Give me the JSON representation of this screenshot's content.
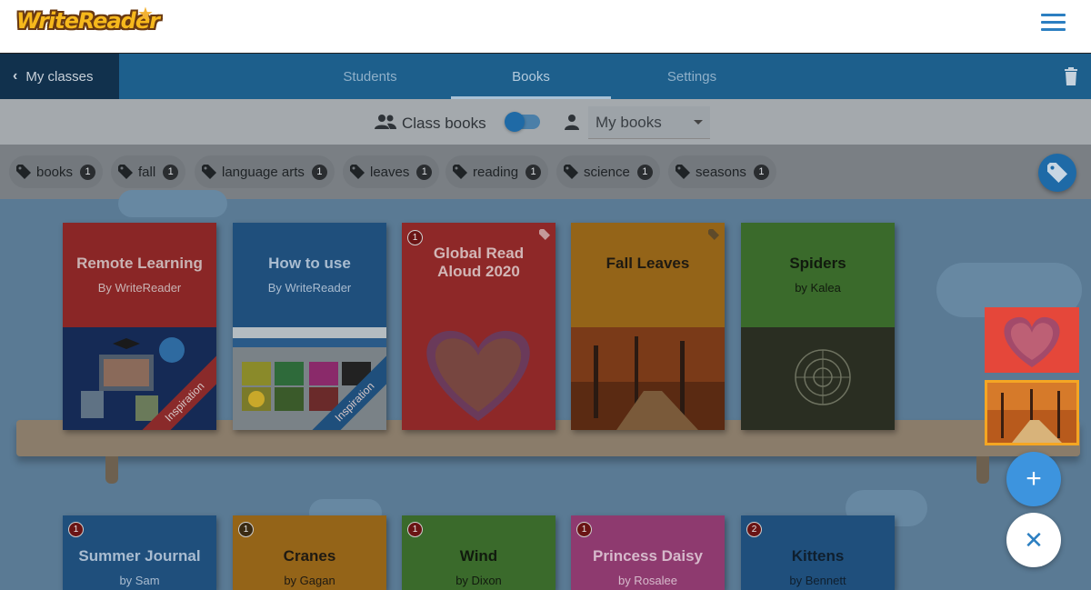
{
  "header": {
    "logo_text": "WriteReader",
    "star_glyph": "★",
    "menu_icon": "hamburger-icon"
  },
  "nav": {
    "back_label": "My classes",
    "tabs": [
      {
        "label": "Students",
        "active": false
      },
      {
        "label": "Books",
        "active": true
      },
      {
        "label": "Settings",
        "active": false
      }
    ],
    "delete_icon": "trash-icon"
  },
  "toolbar": {
    "class_books_label": "Class books",
    "toggle_on": true,
    "select_value": "My books"
  },
  "tags": [
    {
      "label": "books",
      "count": "1"
    },
    {
      "label": "fall",
      "count": "1"
    },
    {
      "label": "language arts",
      "count": "1"
    },
    {
      "label": "leaves",
      "count": "1"
    },
    {
      "label": "reading",
      "count": "1"
    },
    {
      "label": "science",
      "count": "1"
    },
    {
      "label": "seasons",
      "count": "1"
    }
  ],
  "shelf1": [
    {
      "title": "Remote Learning",
      "author": "By WriteReader",
      "ribbon": "Inspiration",
      "color": "#8a2626",
      "text_color": "#c9b3b3"
    },
    {
      "title": "How to use",
      "author": "By WriteReader",
      "ribbon": "Inspiration",
      "color": "#1f4f7c",
      "text_color": "#a9bcd0"
    },
    {
      "title": "Global Read Aloud 2020",
      "author": "",
      "badge": "1",
      "color": "#8e2828",
      "text_color": "#d2b6b6"
    },
    {
      "title": "Fall Leaves",
      "author": "",
      "color": "#946418",
      "text_color": "#1f1a12"
    },
    {
      "title": "Spiders",
      "author": "by Kalea",
      "color": "#3a6a2b",
      "text_color": "#111a0e"
    }
  ],
  "shelf2": [
    {
      "title": "Summer Journal",
      "author": "by Sam",
      "badge": "1",
      "color": "#1f4f7c",
      "text_color": "#a9bcd0"
    },
    {
      "title": "Cranes",
      "author": "by Gagan",
      "badge": "1",
      "color": "#946418",
      "text_color": "#1f1a12"
    },
    {
      "title": "Wind",
      "author": "by Dixon",
      "badge": "1",
      "color": "#3a6a2b",
      "text_color": "#111a0e"
    },
    {
      "title": "Princess Daisy",
      "author": "by Rosalee",
      "badge": "1",
      "color": "#8e3a6f",
      "text_color": "#d6b9cb"
    },
    {
      "title": "Kittens",
      "author": "by Bennett",
      "badge": "2",
      "color": "#1f4f7c",
      "text_color": "#0f1f2e"
    }
  ],
  "fab": {
    "add_glyph": "+",
    "close_glyph": "✕"
  }
}
